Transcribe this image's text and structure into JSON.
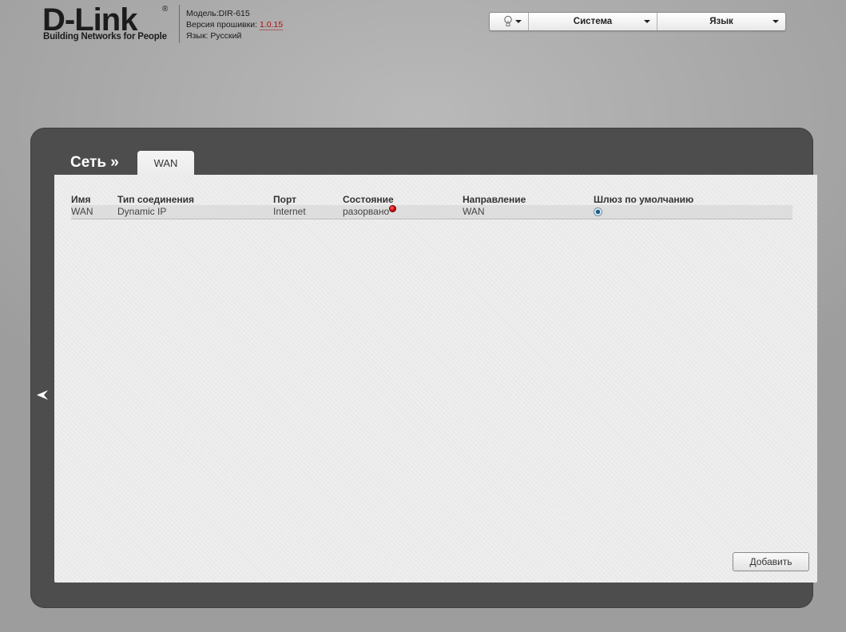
{
  "header": {
    "logo_word": "D-Link",
    "logo_reg": "®",
    "logo_tagline": "Building Networks for People",
    "model_label": "Модель:",
    "model_value": "DIR-615",
    "firmware_label": "Версия прошивки:",
    "firmware_value": "1.0.15",
    "language_label": "Язык:",
    "language_value": "Русский"
  },
  "topmenu": {
    "hint_icon": "lightbulb-icon",
    "system_label": "Система",
    "language_label": "Язык"
  },
  "page": {
    "section_title": "Сеть »",
    "tab_label": "WAN"
  },
  "table": {
    "headers": [
      "Имя",
      "Тип соединения",
      "Порт",
      "Состояние",
      "Направление",
      "Шлюз по умолчанию"
    ],
    "rows": [
      {
        "name": "WAN",
        "type": "Dynamic IP",
        "port": "Internet",
        "state": "разорвано",
        "state_icon": "disconnected-status-icon",
        "direction": "WAN",
        "default_gateway": true
      }
    ]
  },
  "buttons": {
    "add_label": "Добавить"
  },
  "colors": {
    "panel_dark": "#4d4d4d",
    "content_bg": "#ececec",
    "firmware_link": "#b01010",
    "status_red": "#d00000"
  }
}
